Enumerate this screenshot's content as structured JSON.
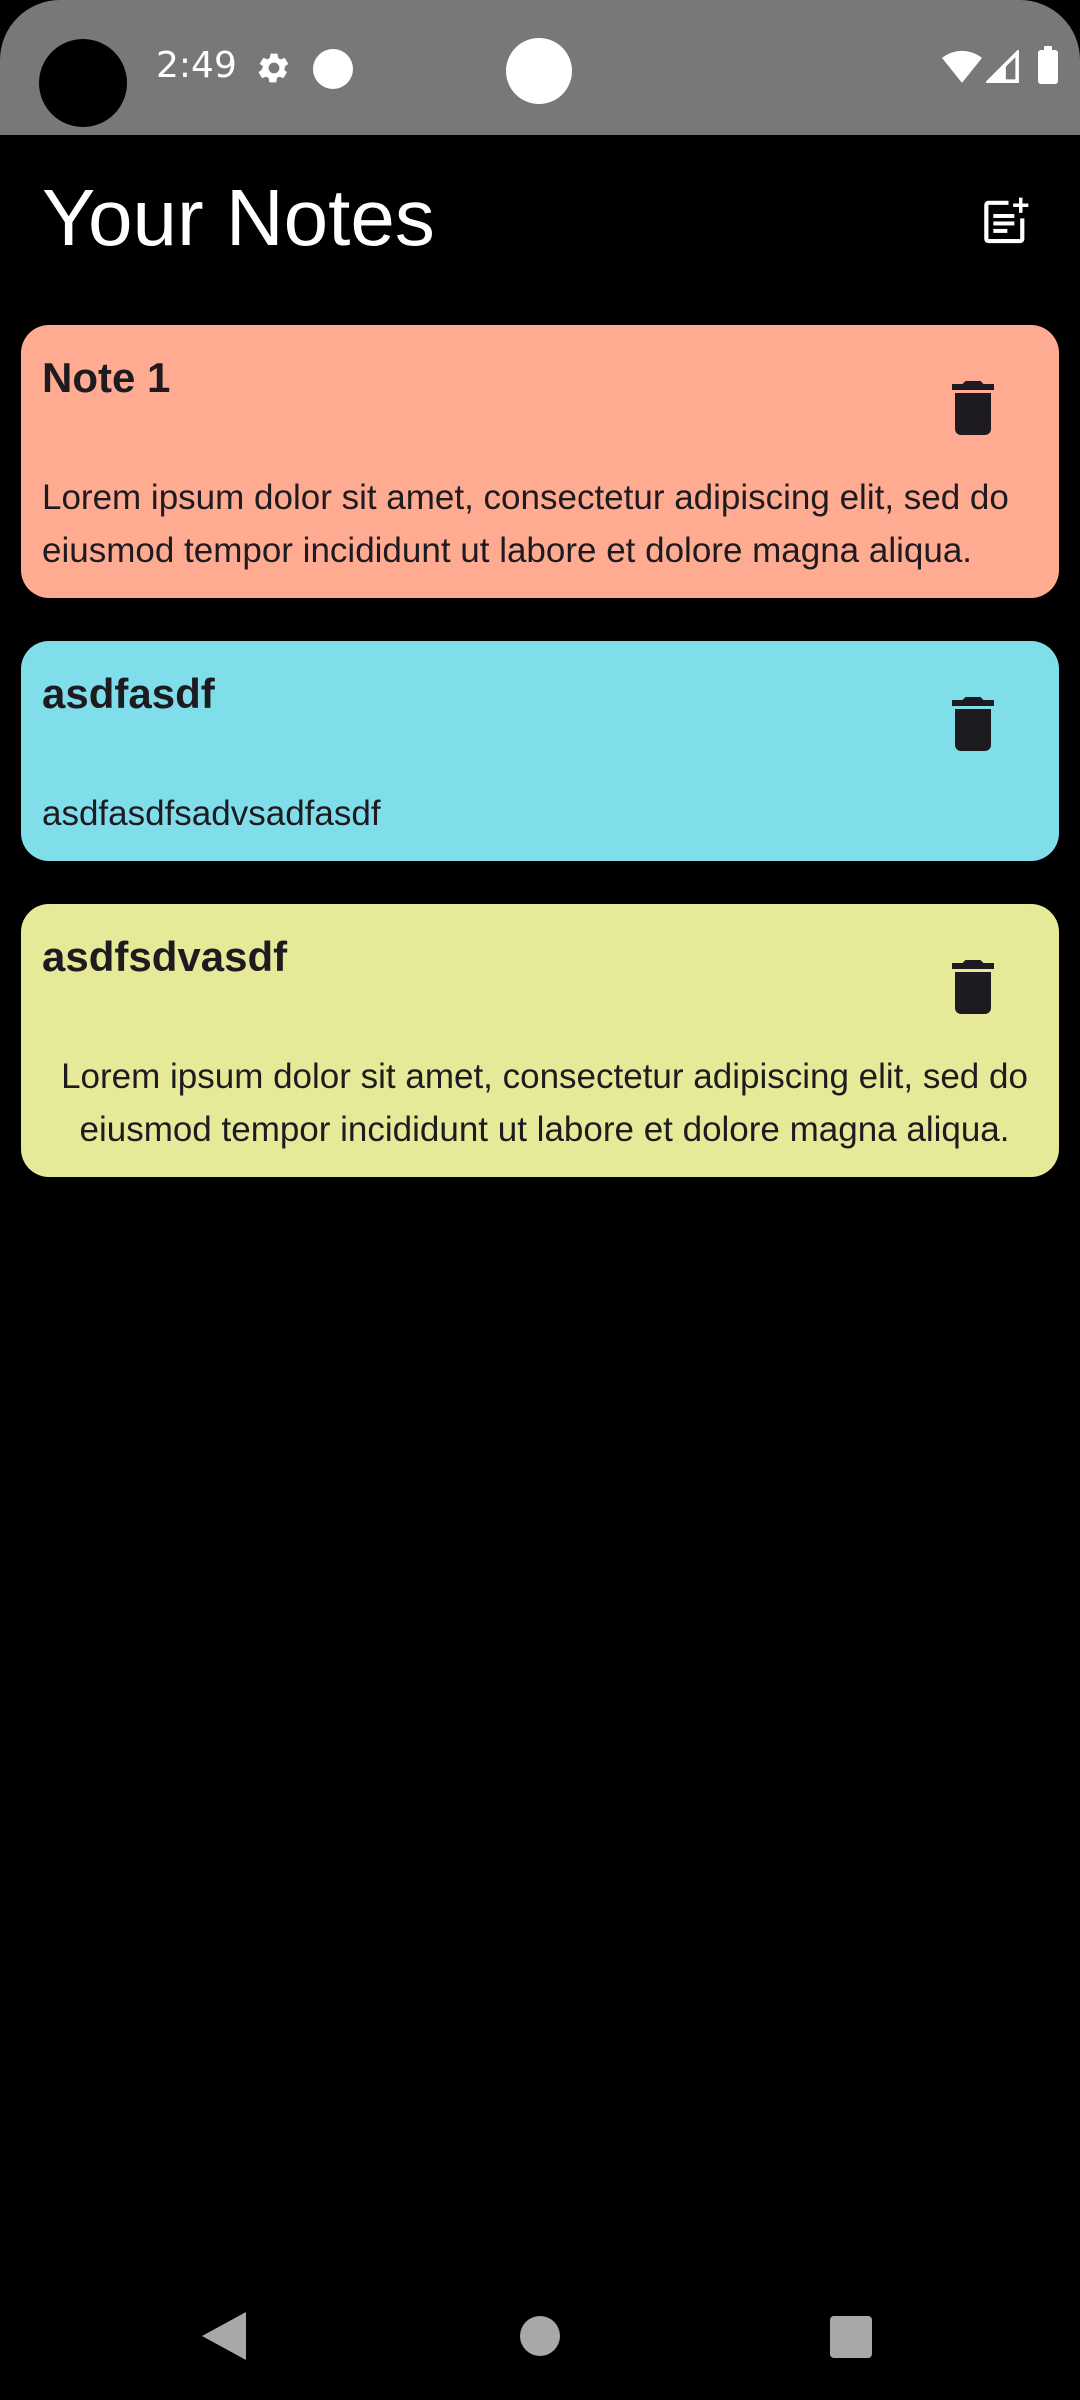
{
  "status_bar": {
    "time": "2:49"
  },
  "header": {
    "title": "Your Notes",
    "add_note_icon": "note-add-icon"
  },
  "notes": [
    {
      "title": "Note 1",
      "content": "Lorem ipsum dolor sit amet, consectetur adipiscing elit, sed do eiusmod tempor incididunt ut labore et dolore magna aliqua.",
      "color": "#ffab91"
    },
    {
      "title": "asdfasdf",
      "content": "asdfasdfsadvsadfasdf",
      "color": "#80deea"
    },
    {
      "title": "asdfsdvasdf",
      "content": "Lorem ipsum dolor sit amet, consectetur adipiscing elit, sed do eiusmod tempor incididunt ut labore et dolore magna aliqua.",
      "color": "#e6ea98"
    }
  ],
  "colors": {
    "background": "#000000",
    "status_bar": "#787878",
    "nav_icons": "#a8a8a8"
  },
  "icons": {
    "delete": "trash-icon",
    "settings": "gear-icon",
    "wifi": "wifi-icon",
    "signal": "signal-icon",
    "battery": "battery-icon"
  }
}
